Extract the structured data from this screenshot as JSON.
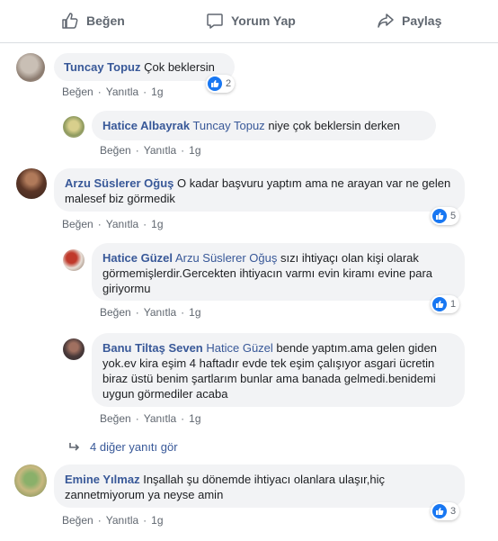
{
  "actions": {
    "like": "Beğen",
    "comment": "Yorum Yap",
    "share": "Paylaş"
  },
  "meta": {
    "like": "Beğen",
    "reply": "Yanıtla",
    "time": "1g"
  },
  "comments": [
    {
      "author": "Tuncay Topuz",
      "text": "Çok beklersin",
      "reactions": "2"
    },
    {
      "author": "Hatice Albayrak",
      "tag": "Tuncay Topuz",
      "text": "niye çok beklersin derken"
    },
    {
      "author": "Arzu Süslerer Oğuş",
      "text": "O kadar başvuru yaptım ama ne arayan var ne gelen malesef biz görmedik",
      "reactions": "5"
    },
    {
      "author": "Hatice Güzel",
      "tag": "Arzu Süslerer Oğuş",
      "text": "sızı ihtiyaçı olan kişi olarak görmemişlerdir.Gercekten ihtiyacın varmı evin kiramı evine para giriyormu",
      "reactions": "1"
    },
    {
      "author": "Banu Tiltaş Seven",
      "tag": "Hatice Güzel",
      "text": "bende yaptım.ama gelen giden yok.ev kira eşim 4 haftadır evde tek eşim çalışıyor asgari ücretin biraz üstü benim şartlarım bunlar ama banada gelmedi.benidemi uygun görmediler acaba"
    },
    {
      "author": "Emine Yılmaz",
      "text": "Inşallah şu dönemde ihtiyacı olanlara ulaşır,hiç zannetmiyorum ya neyse amin",
      "reactions": "3"
    }
  ],
  "more_replies": "4 diğer yanıtı gör"
}
